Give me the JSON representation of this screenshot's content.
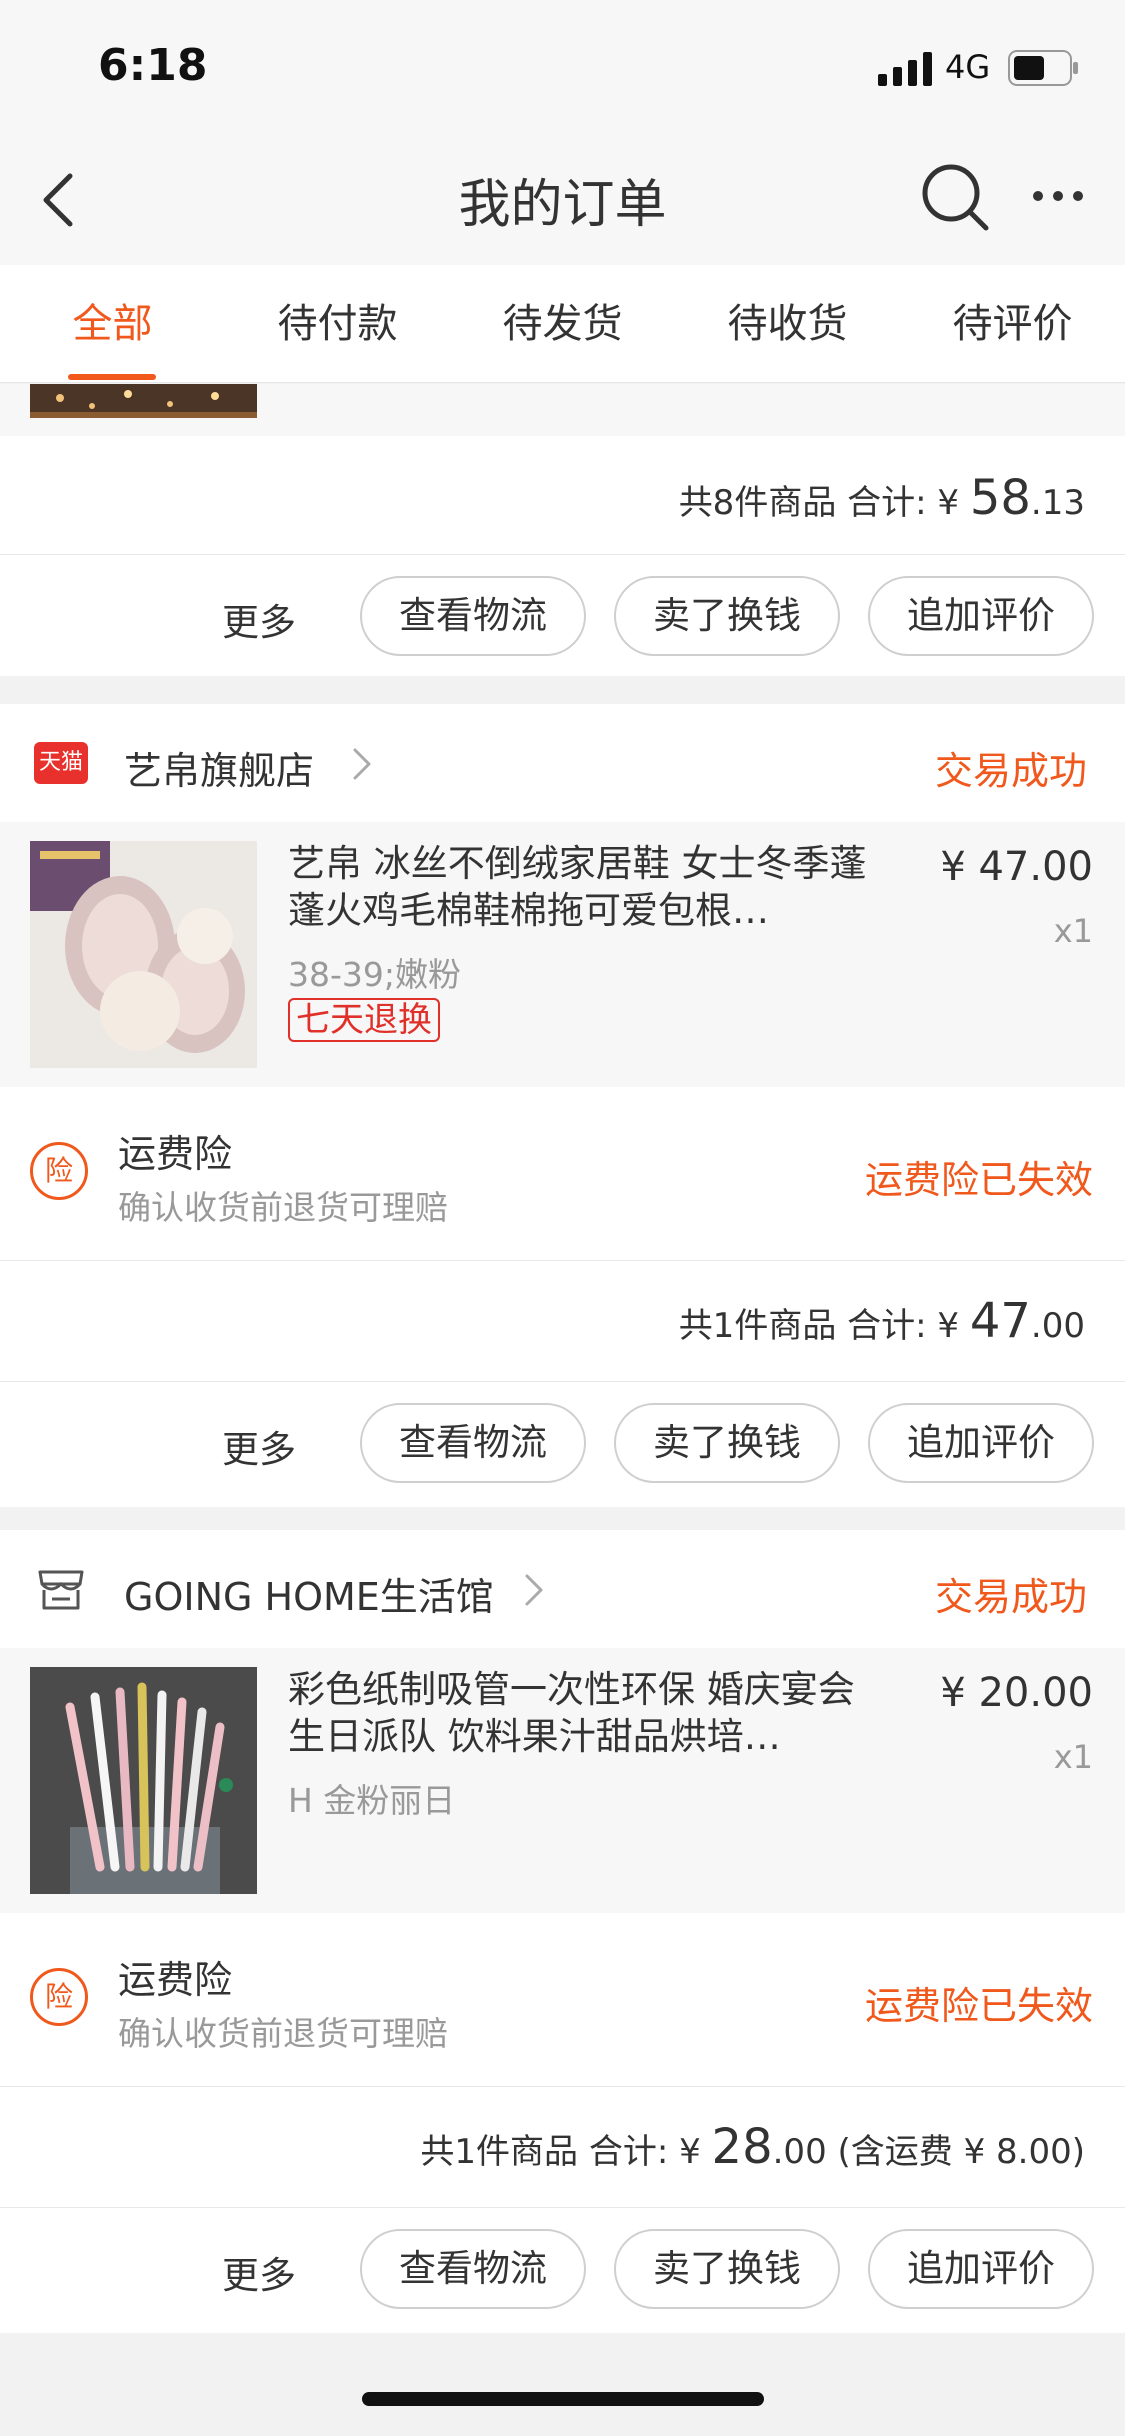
{
  "status_bar": {
    "time": "6:18",
    "network": "4G"
  },
  "nav": {
    "title": "我的订单"
  },
  "tabs": [
    "全部",
    "待付款",
    "待发货",
    "待收货",
    "待评价"
  ],
  "actions": {
    "more": "更多",
    "logistics": "查看物流",
    "resell": "卖了换钱",
    "review": "追加评价"
  },
  "order1": {
    "summary_prefix": "共8件商品 合计: ¥",
    "total_int": "58",
    "total_dec": ".13"
  },
  "order2": {
    "shop_badge": "天猫",
    "shop_name": "艺帛旗舰店",
    "status": "交易成功",
    "product_title": "艺帛 冰丝不倒绒家居鞋 女士冬季蓬蓬火鸡毛棉鞋棉拖可爱包根…",
    "spec": "38-39;嫩粉",
    "tag": "七天退换",
    "price": "¥ 47.00",
    "qty": "x1",
    "insurance_badge": "险",
    "insurance_title": "运费险",
    "insurance_sub": "确认收货前退货可理赔",
    "insurance_status": "运费险已失效",
    "summary_prefix": "共1件商品 合计: ¥",
    "total_int": "47",
    "total_dec": ".00"
  },
  "order3": {
    "shop_name": "GOING HOME生活馆",
    "status": "交易成功",
    "product_title": "彩色纸制吸管一次性环保 婚庆宴会生日派队 饮料果汁甜品烘培…",
    "spec": "H  金粉丽日",
    "price": "¥ 20.00",
    "qty": "x1",
    "insurance_badge": "险",
    "insurance_title": "运费险",
    "insurance_sub": "确认收货前退货可理赔",
    "insurance_status": "运费险已失效",
    "summary_prefix": "共1件商品 合计: ¥",
    "total_int": "28",
    "total_dec": ".00",
    "shipping_note": " (含运费 ¥ 8.00)"
  },
  "colors": {
    "accent": "#f0581c",
    "tag_red": "#e0302a"
  }
}
